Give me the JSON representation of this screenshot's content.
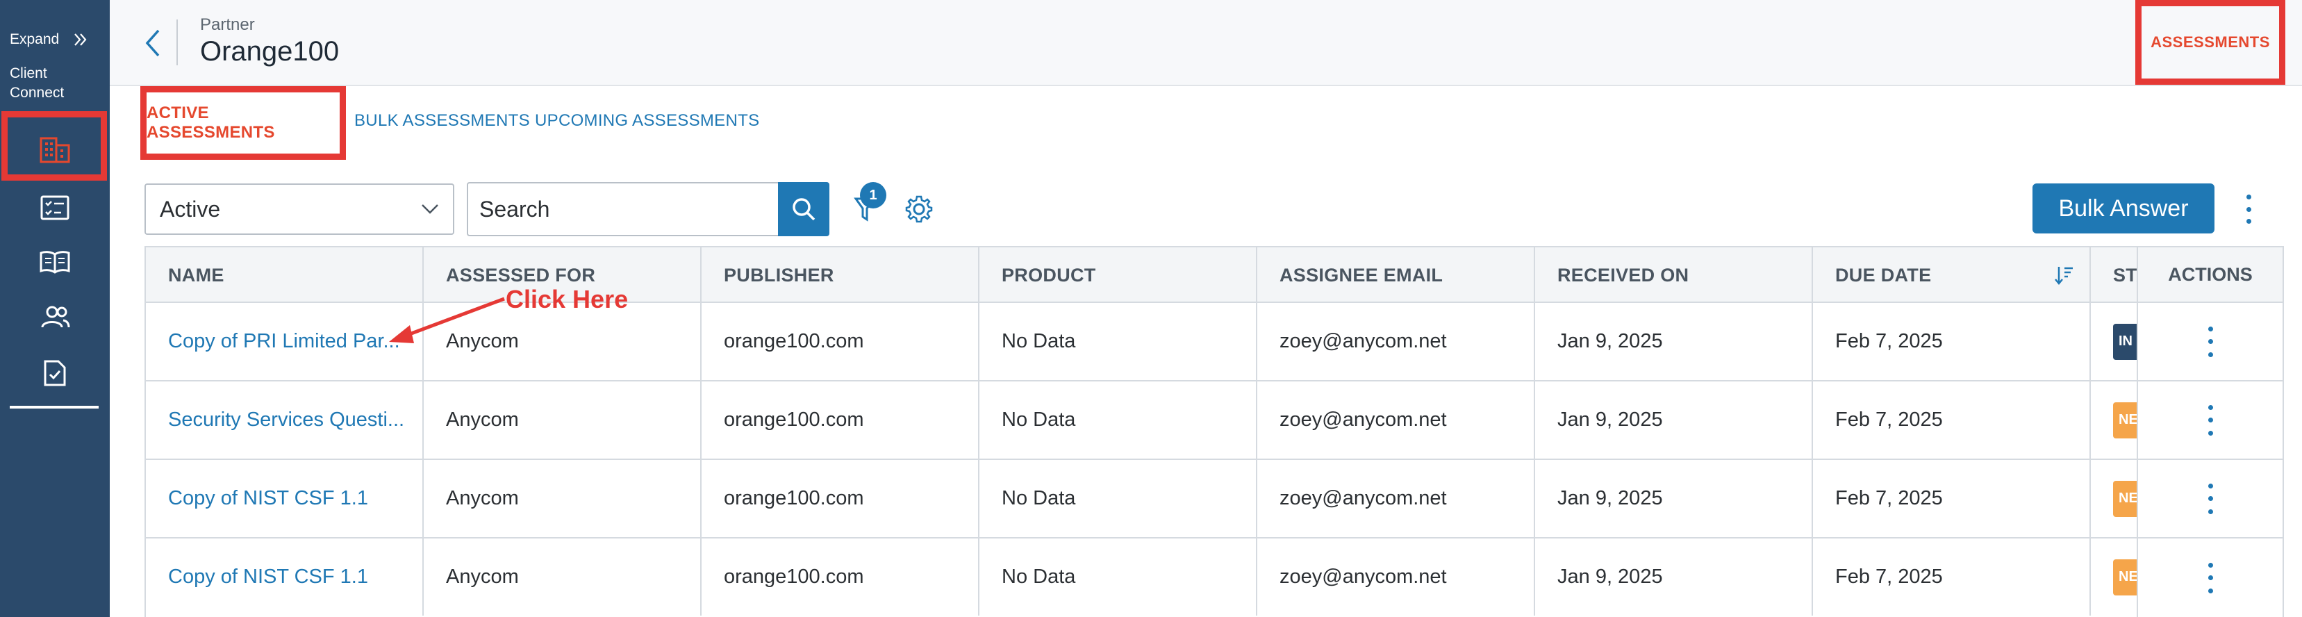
{
  "sidebar": {
    "expand_label": "Expand",
    "client_connect_label": "Client Connect",
    "icons": [
      "building-icon",
      "checklist-icon",
      "book-icon",
      "users-icon",
      "document-check-icon"
    ]
  },
  "header": {
    "subtitle": "Partner",
    "title": "Orange100",
    "assessments_link": "ASSESSMENTS"
  },
  "tabs": [
    {
      "label": "ACTIVE ASSESSMENTS",
      "active": true
    },
    {
      "label": "BULK ASSESSMENTS",
      "active": false
    },
    {
      "label": "UPCOMING ASSESSMENTS",
      "active": false
    }
  ],
  "toolbar": {
    "status_select_value": "Active",
    "search_placeholder": "Search",
    "filter_count": "1",
    "bulk_answer_label": "Bulk Answer"
  },
  "table": {
    "columns": [
      "NAME",
      "ASSESSED FOR",
      "PUBLISHER",
      "PRODUCT",
      "ASSIGNEE EMAIL",
      "RECEIVED ON",
      "DUE DATE",
      "STATUS",
      "ACTIONS"
    ],
    "rows": [
      {
        "name": "Copy of PRI Limited Par...",
        "assessed_for": "Anycom",
        "publisher": "orange100.com",
        "product": "No Data",
        "assignee_email": "zoey@anycom.net",
        "received_on": "Jan 9, 2025",
        "due_date": "Feb 7, 2025",
        "status": "IN",
        "status_color": "#2b4a6b"
      },
      {
        "name": "Security Services Questi...",
        "assessed_for": "Anycom",
        "publisher": "orange100.com",
        "product": "No Data",
        "assignee_email": "zoey@anycom.net",
        "received_on": "Jan 9, 2025",
        "due_date": "Feb 7, 2025",
        "status": "NE",
        "status_color": "#f5a54a"
      },
      {
        "name": "Copy of NIST CSF 1.1",
        "assessed_for": "Anycom",
        "publisher": "orange100.com",
        "product": "No Data",
        "assignee_email": "zoey@anycom.net",
        "received_on": "Jan 9, 2025",
        "due_date": "Feb 7, 2025",
        "status": "NE",
        "status_color": "#f5a54a"
      },
      {
        "name": "Copy of NIST CSF 1.1",
        "assessed_for": "Anycom",
        "publisher": "orange100.com",
        "product": "No Data",
        "assignee_email": "zoey@anycom.net",
        "received_on": "Jan 9, 2025",
        "due_date": "Feb 7, 2025",
        "status": "NE",
        "status_color": "#f5a54a"
      }
    ]
  },
  "annotation": {
    "text": "Click Here"
  },
  "colors": {
    "sidebar_bg": "#2b4a6b",
    "accent": "#1f78b4",
    "highlight": "#e53935"
  }
}
